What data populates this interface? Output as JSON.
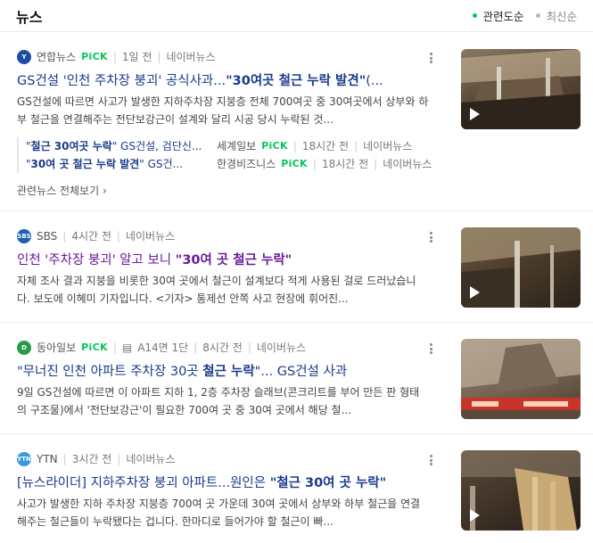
{
  "header": {
    "title": "뉴스",
    "sort_relevance": "관련도순",
    "sort_latest": "최신순"
  },
  "items": [
    {
      "source": "연합뉴스",
      "pick": "PiCK",
      "time": "1일 전",
      "portal": "네이버뉴스",
      "title_pre": "GS건설 '인천 주차장 붕괴' 공식사과...",
      "title_em": "\"30여곳 철근 누락 발견\"",
      "title_post": "(...",
      "desc": "GS건설에 따르면 사고가 발생한 지하주차장 지붕층 전체 700여곳 중 30여곳에서 상부와 하부 철근을 연결해주는 전단보강근이 설계와 달리 시공 당시 누락된 것...",
      "subs": [
        {
          "title_pre": "\"",
          "title_em": "철근 30여곳 누락",
          "title_post": "\" GS건설, 검단신...",
          "source": "세계일보",
          "pick": "PiCK",
          "time": "18시간 전",
          "portal": "네이버뉴스"
        },
        {
          "title_pre": "\"",
          "title_em": "30여 곳 철근 누락 발견",
          "title_post": "\" GS건...",
          "source": "한경비즈니스",
          "pick": "PiCK",
          "time": "18시간 전",
          "portal": "네이버뉴스"
        }
      ],
      "related": "관련뉴스 전체보기 ›"
    },
    {
      "source": "SBS",
      "time": "4시간 전",
      "portal": "네이버뉴스",
      "title_pre": "인천 '주차장 붕괴' 알고 보니 ",
      "title_em": "\"30여 곳 철근 누락\"",
      "title_post": "",
      "desc": "자체 조사 결과 지붕을 비롯한 30여 곳에서 철근이 설계보다 적게 사용된 걸로 드러났습니다. 보도에 이혜미 기자입니다. <기자> 통제선 안쪽 사고 현장에 휘어진..."
    },
    {
      "source": "동아일보",
      "pick": "PiCK",
      "page": "A14면 1단",
      "time": "8시간 전",
      "portal": "네이버뉴스",
      "title_pre": "\"무너진 인천 아파트 주차장 30곳 ",
      "title_em": "철근 누락",
      "title_post": "\"... GS건설 사과",
      "desc": "9일 GS건설에 따르면 이 아파트 지하 1, 2층 주차장 슬래브(콘크리트를 부어 만든 판 형태의 구조물)에서 '전단보강근'이 필요한 700여 곳 중 30여 곳에서 해당 철..."
    },
    {
      "source": "YTN",
      "time": "3시간 전",
      "portal": "네이버뉴스",
      "title_pre": "[뉴스라이더] 지하주차장 붕괴 아파트...원인은 ",
      "title_em": "\"철근 30여 곳 누락\"",
      "title_post": "",
      "desc": "사고가 발생한 지하 주차장 지붕층 700여 곳 가운데 30여 곳에서 상부와 하부 철근을 연결해주는 철근들이 누락됐다는 겁니다. 한마디로 들어가야 할 철근이 빠..."
    }
  ]
}
